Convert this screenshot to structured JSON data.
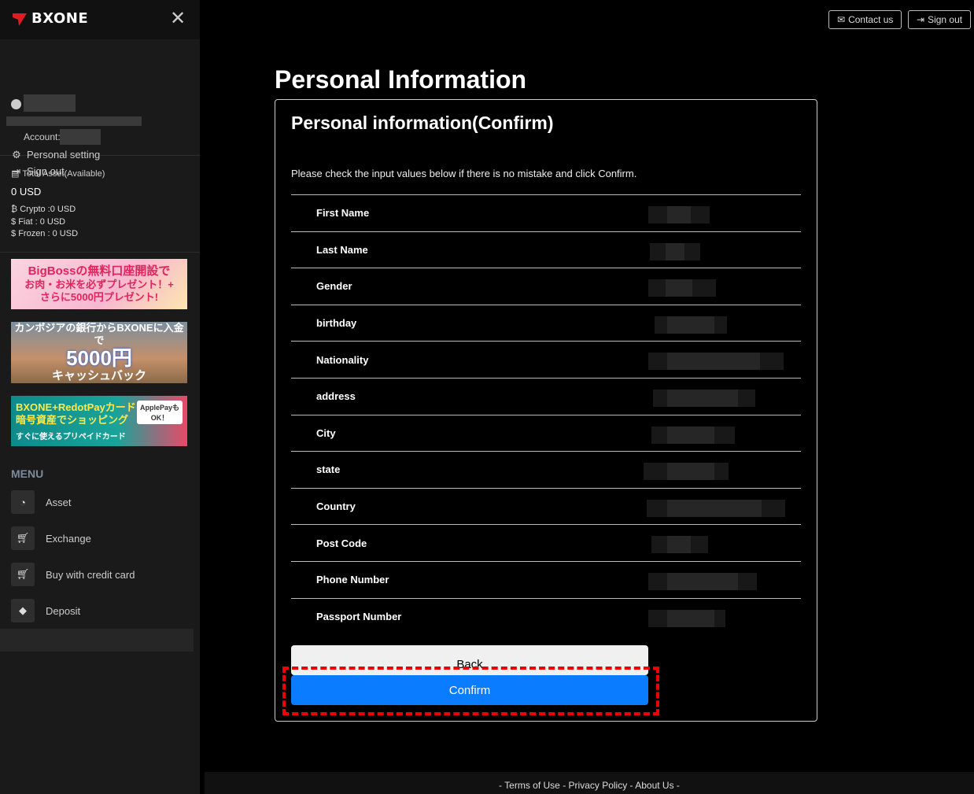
{
  "brand": {
    "name": "BXONE"
  },
  "sidebar": {
    "account_label": "Account:",
    "personal_setting": "Personal setting",
    "sign_out": "Sign out",
    "asset_title": "Total Asset(Available)",
    "asset_total": "0 USD",
    "crypto_label": "Crypto :",
    "crypto_value": "0 USD",
    "fiat_label": "Fiat :",
    "fiat_value": "0 USD",
    "frozen_label": "Frozen :",
    "frozen_value": "0 USD",
    "menu_title": "MENU",
    "menu_items": [
      {
        "label": "Asset",
        "icon": "dashboard-icon"
      },
      {
        "label": "Exchange",
        "icon": "cart-icon"
      },
      {
        "label": "Buy with credit card",
        "icon": "cart-icon"
      },
      {
        "label": "Deposit",
        "icon": "diamond-icon"
      }
    ]
  },
  "banners": [
    {
      "line1": "BigBossの無料口座開設で",
      "line2": "お肉・お米を必ずプレゼント！+",
      "line3": "さらに5000円プレゼント!"
    },
    {
      "line1": "カンボジアの銀行からBXONEに入金で",
      "line2": "5000円",
      "line3": "キャッシュバック"
    },
    {
      "line1": "BXONE+RedotPayカード",
      "line2": "暗号資産でショッピング",
      "line3": "すぐに使えるプリペイドカード",
      "badge": "ApplePayも OK！"
    }
  ],
  "topbar": {
    "contact": "Contact us",
    "signout": "Sign out"
  },
  "main": {
    "page_title": "Personal Information",
    "card_title": "Personal information(Confirm)",
    "description": "Please check the input values below if there is no mistake and click Confirm.",
    "rows": [
      {
        "label": "First Name"
      },
      {
        "label": "Last Name"
      },
      {
        "label": "Gender"
      },
      {
        "label": "birthday"
      },
      {
        "label": "Nationality"
      },
      {
        "label": "address"
      },
      {
        "label": "City"
      },
      {
        "label": "state"
      },
      {
        "label": "Country"
      },
      {
        "label": "Post Code"
      },
      {
        "label": "Phone Number"
      },
      {
        "label": "Passport Number"
      }
    ],
    "back_label": "Back",
    "confirm_label": "Confirm"
  },
  "footer": {
    "terms": "Terms of Use",
    "privacy": "Privacy Policy",
    "about": "About Us"
  },
  "colors": {
    "accent": "#0a7cff",
    "highlight": "#ee0000"
  }
}
